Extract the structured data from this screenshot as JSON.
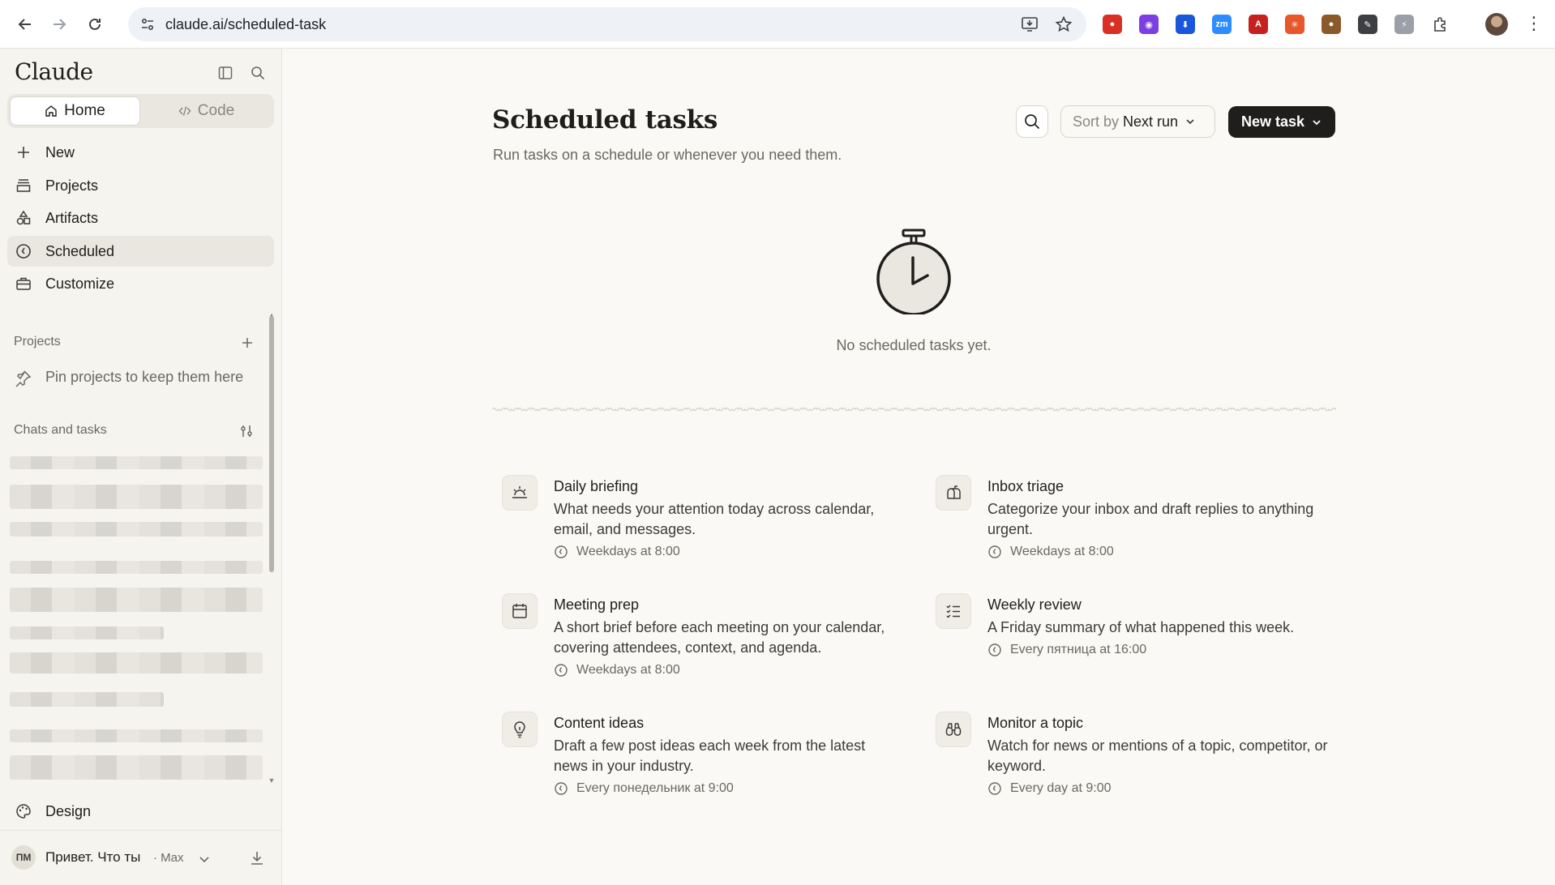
{
  "browser": {
    "url": "claude.ai/scheduled-task",
    "extensions": [
      {
        "name": "screen-recorder-icon",
        "color": "#d93025",
        "glyph": "●"
      },
      {
        "name": "color-picker-icon",
        "color": "#7b3fe4",
        "glyph": "◉"
      },
      {
        "name": "download-extension-icon",
        "color": "#1a56db",
        "glyph": "⬇"
      },
      {
        "name": "zoom-icon",
        "color": "#2d8cff",
        "glyph": "zm"
      },
      {
        "name": "pdf-icon",
        "color": "#c5221f",
        "glyph": "A"
      },
      {
        "name": "claude-extension-icon",
        "color": "#e8562a",
        "glyph": "✳"
      },
      {
        "name": "cookie-icon",
        "color": "#8a5a2b",
        "glyph": "●"
      },
      {
        "name": "signature-icon",
        "color": "#3c4043",
        "glyph": "✎"
      },
      {
        "name": "gray-extension-icon",
        "color": "#9aa0a6",
        "glyph": "⚡"
      }
    ]
  },
  "sidebar": {
    "brand": "Claude",
    "modes": {
      "home": "Home",
      "code": "Code"
    },
    "nav": [
      {
        "id": "new",
        "label": "New",
        "icon": "plus-icon"
      },
      {
        "id": "projects",
        "label": "Projects",
        "icon": "projects-icon"
      },
      {
        "id": "artifacts",
        "label": "Artifacts",
        "icon": "artifacts-icon"
      },
      {
        "id": "scheduled",
        "label": "Scheduled",
        "icon": "clock-icon",
        "selected": true
      },
      {
        "id": "customize",
        "label": "Customize",
        "icon": "briefcase-icon"
      }
    ],
    "projects_label": "Projects",
    "pin_hint": "Pin projects to keep them here",
    "chats_label": "Chats and tasks",
    "design_label": "Design",
    "user": {
      "initials": "ПМ",
      "name": "Привет. Что ты",
      "plan": "· Max"
    }
  },
  "main": {
    "title": "Scheduled tasks",
    "subtitle": "Run tasks on a schedule or whenever you need them.",
    "sort_prefix": "Sort by",
    "sort_value": "Next run",
    "new_task_label": "New task",
    "empty_state": "No scheduled tasks yet.",
    "templates": [
      {
        "title": "Daily briefing",
        "description": "What needs your attention today across calendar, email, and messages.",
        "schedule": "Weekdays at 8:00",
        "icon": "sunrise-icon"
      },
      {
        "title": "Inbox triage",
        "description": "Categorize your inbox and draft replies to anything urgent.",
        "schedule": "Weekdays at 8:00",
        "icon": "mailbox-icon"
      },
      {
        "title": "Meeting prep",
        "description": "A short brief before each meeting on your calendar, covering attendees, context, and agenda.",
        "schedule": "Weekdays at 8:00",
        "icon": "calendar-icon"
      },
      {
        "title": "Weekly review",
        "description": "A Friday summary of what happened this week.",
        "schedule": "Every пятница at 16:00",
        "icon": "checklist-icon"
      },
      {
        "title": "Content ideas",
        "description": "Draft a few post ideas each week from the latest news in your industry.",
        "schedule": "Every понедельник at 9:00",
        "icon": "lightbulb-icon"
      },
      {
        "title": "Monitor a topic",
        "description": "Watch for news or mentions of a topic, competitor, or keyword.",
        "schedule": "Every day at 9:00",
        "icon": "binoculars-icon"
      }
    ]
  }
}
